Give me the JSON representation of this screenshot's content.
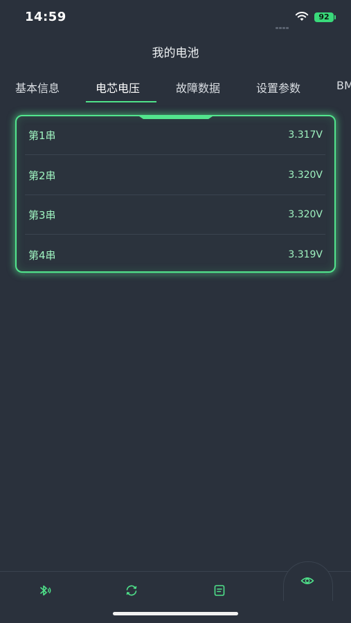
{
  "status_bar": {
    "time": "14:59",
    "battery": "92"
  },
  "header": {
    "title": "我的电池"
  },
  "tabs": [
    {
      "label": "基本信息",
      "active": false
    },
    {
      "label": "电芯电压",
      "active": true
    },
    {
      "label": "故障数据",
      "active": false
    },
    {
      "label": "设置参数",
      "active": false
    },
    {
      "label": "BMS",
      "active": false
    }
  ],
  "cells": [
    {
      "label": "第1串",
      "value": "3.317V"
    },
    {
      "label": "第2串",
      "value": "3.320V"
    },
    {
      "label": "第3串",
      "value": "3.320V"
    },
    {
      "label": "第4串",
      "value": "3.319V"
    }
  ],
  "bottom_nav": [
    {
      "icon": "bluetooth-icon"
    },
    {
      "icon": "refresh-icon"
    },
    {
      "icon": "document-icon"
    },
    {
      "icon": "eye-icon"
    }
  ],
  "colors": {
    "accent": "#52e58d",
    "background": "#2a313c",
    "value_text": "#9ff3c0"
  }
}
